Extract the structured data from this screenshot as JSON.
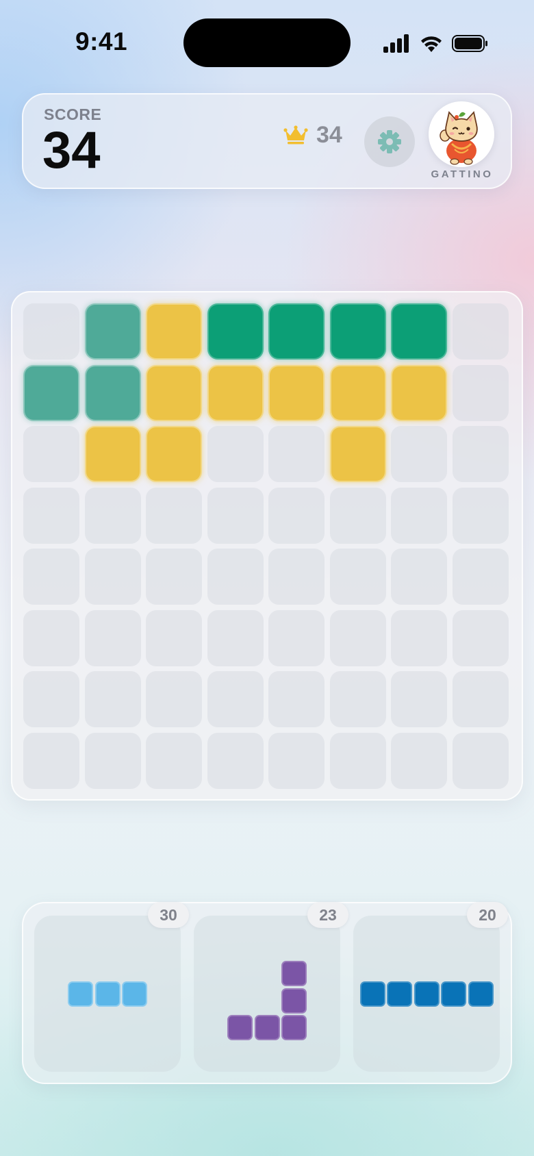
{
  "status_bar": {
    "time": "9:41"
  },
  "header": {
    "score_label": "SCORE",
    "score_value": "34",
    "best_score": "34",
    "player_name": "GATTINO"
  },
  "board": {
    "rows": 8,
    "cols": 8,
    "filled_cells": [
      {
        "row": 0,
        "col": 1,
        "color": "teal"
      },
      {
        "row": 0,
        "col": 2,
        "color": "yellow"
      },
      {
        "row": 0,
        "col": 3,
        "color": "green"
      },
      {
        "row": 0,
        "col": 4,
        "color": "green"
      },
      {
        "row": 0,
        "col": 5,
        "color": "green"
      },
      {
        "row": 0,
        "col": 6,
        "color": "green"
      },
      {
        "row": 1,
        "col": 0,
        "color": "teal"
      },
      {
        "row": 1,
        "col": 1,
        "color": "teal"
      },
      {
        "row": 1,
        "col": 2,
        "color": "yellow"
      },
      {
        "row": 1,
        "col": 3,
        "color": "yellow"
      },
      {
        "row": 1,
        "col": 4,
        "color": "yellow"
      },
      {
        "row": 1,
        "col": 5,
        "color": "yellow"
      },
      {
        "row": 1,
        "col": 6,
        "color": "yellow"
      },
      {
        "row": 2,
        "col": 1,
        "color": "yellow"
      },
      {
        "row": 2,
        "col": 2,
        "color": "yellow"
      },
      {
        "row": 2,
        "col": 5,
        "color": "yellow"
      }
    ]
  },
  "pieces": [
    {
      "badge": "30",
      "color": "sky",
      "cells": [
        [
          0,
          0
        ],
        [
          0,
          1
        ],
        [
          0,
          2
        ]
      ]
    },
    {
      "badge": "23",
      "color": "purple",
      "cells": [
        [
          0,
          2
        ],
        [
          1,
          2
        ],
        [
          2,
          0
        ],
        [
          2,
          1
        ],
        [
          2,
          2
        ]
      ]
    },
    {
      "badge": "20",
      "color": "blue",
      "cells": [
        [
          0,
          0
        ],
        [
          0,
          1
        ],
        [
          0,
          2
        ],
        [
          0,
          3
        ],
        [
          0,
          4
        ]
      ]
    }
  ],
  "colors": {
    "teal": "#4faa98",
    "green": "#0c9f76",
    "yellow": "#ecc346",
    "sky": "#5bb6e8",
    "purple": "#7b55a6",
    "blue": "#0973b7",
    "crown": "#f2be2f",
    "gear": "#7cbcb4"
  },
  "icons": {
    "best": "crown-icon",
    "settings": "gear-icon",
    "avatar": "cat-avatar-icon"
  }
}
